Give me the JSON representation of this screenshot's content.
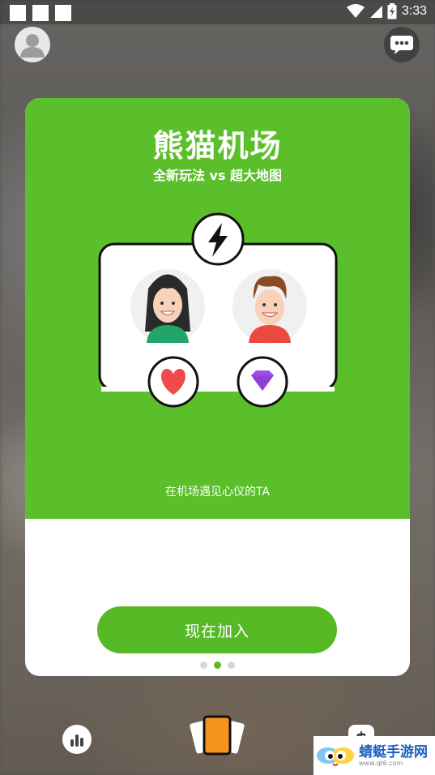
{
  "status_bar": {
    "time": "3:33"
  },
  "card": {
    "title": "熊猫机场",
    "subtitle": "全新玩法 vs 超大地图",
    "tagline": "在机场遇见心仪的TA",
    "join_label": "现在加入",
    "pager": {
      "count": 3,
      "active": 2
    }
  },
  "watermark": {
    "name": "蜻蜓手游网",
    "url": "www.qt6.com"
  },
  "colors": {
    "accent": "#5abf2a",
    "button": "#56b926",
    "heart": "#ef4b4b",
    "gem": "#a24ee6",
    "card_bg": "#ffffff"
  },
  "icons": {
    "top_left": "avatar-icon",
    "top_right": "chat-icon",
    "badge_top": "lightning-icon",
    "badge_left": "heart-icon",
    "badge_right": "gem-icon",
    "bottom_left": "stats-icon",
    "bottom_center": "cards-icon",
    "bottom_right": "dollar-icon"
  }
}
